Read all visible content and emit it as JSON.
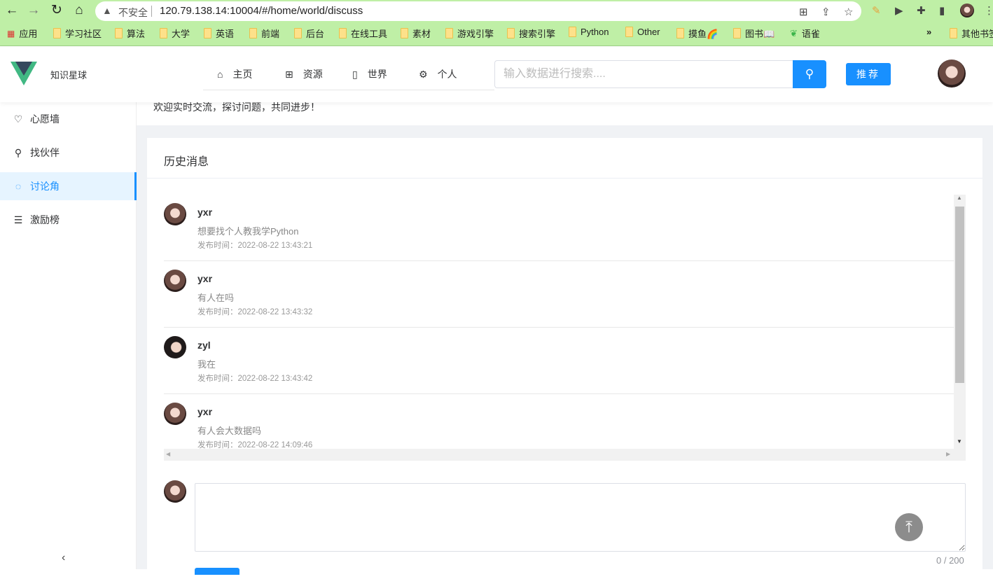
{
  "browser": {
    "security_label": "不安全",
    "url": "120.79.138.14:10004/#/home/world/discuss",
    "bookmarks": [
      "应用",
      "学习社区",
      "算法",
      "大学",
      "英语",
      "前端",
      "后台",
      "在线工具",
      "素材",
      "游戏引擎",
      "搜索引擎",
      "Python",
      "Other",
      "摸鱼🌈",
      "图书📖",
      "语雀"
    ],
    "more": "»",
    "other_bookmarks": "其他书签"
  },
  "header": {
    "site_name": "知识星球",
    "nav": [
      "主页",
      "资源",
      "世界",
      "个人"
    ],
    "search_placeholder": "输入数据进行搜索....",
    "recommend_label": "推荐"
  },
  "sidebar": {
    "items": [
      "心愿墙",
      "找伙伴",
      "讨论角",
      "激励榜"
    ],
    "active": "讨论角"
  },
  "main": {
    "welcome": "欢迎实时交流，探讨问题，共同进步！",
    "card_title": "历史消息",
    "messages": [
      {
        "user": "yxr",
        "content": "想要找个人教我学Python",
        "time": "发布时间：2022-08-22 13:43:21"
      },
      {
        "user": "yxr",
        "content": "有人在吗",
        "time": "发布时间：2022-08-22 13:43:32"
      },
      {
        "user": "zyl",
        "content": "我在",
        "time": "发布时间：2022-08-22 13:43:42"
      },
      {
        "user": "yxr",
        "content": "有人会大数据吗",
        "time": "发布时间：2022-08-22 14:09:46"
      }
    ],
    "input_value": "",
    "counter": "0 / 200"
  },
  "colors": {
    "accent": "#1890ff",
    "browser_bar": "#bfefa6",
    "background": "#f0f2f5"
  }
}
